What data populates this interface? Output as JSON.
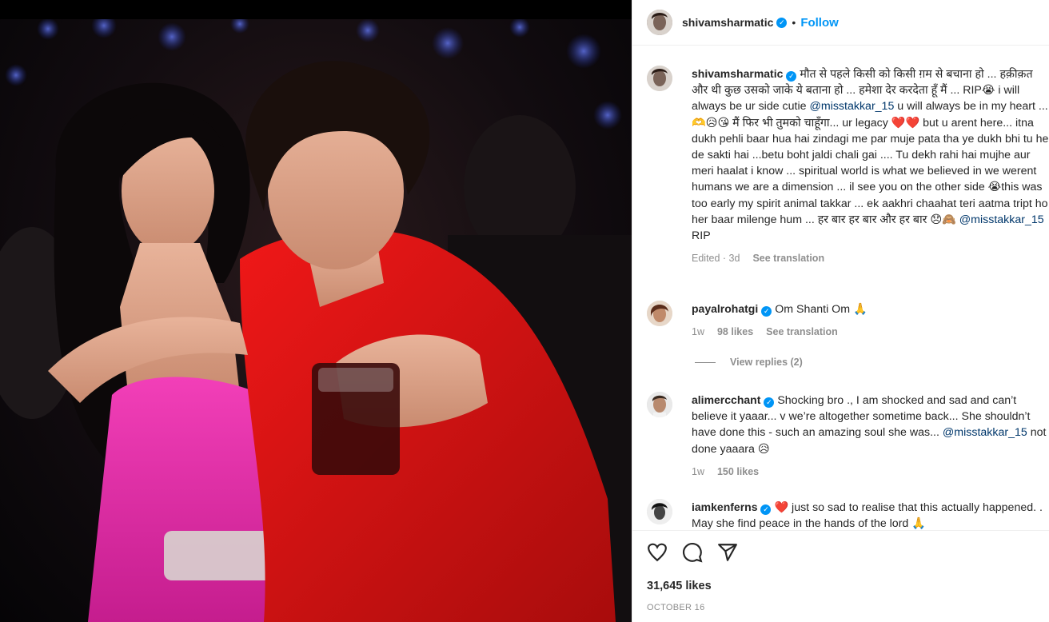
{
  "post": {
    "author": "shivamsharmatic",
    "follow_label": "Follow",
    "separator": "•",
    "caption": {
      "username": "shivamsharmatic",
      "text_1": "मौत से पहले किसी को किसी ग़म से बचाना हो ... हक़ीक़त और थी कुछ उसको जाके ये बताना हो ... हमेशा देर करदेता हूँ मैं ... RIP😭 i will always be ur side cutie ",
      "mention_1": "@misstakkar_15",
      "text_2": " u will always be in my heart ... 🫶😥😘 मैं फिर भी तुमको चाहूँगा... ur legacy ❤️❤️ but u arent here... itna dukh pehli baar hua hai zindagi me par muje pata tha ye dukh bhi tu he de sakti hai ...betu boht jaldi chali gai .... Tu dekh rahi hai mujhe aur meri haalat i know ... spiritual world is what we believed in we werent humans we are a dimension ... il see you on the other side 😭this was too early my spirit animal takkar ... ek aakhri chaahat teri aatma tript ho her baar milenge hum ... हर बार हर बार और हर बार 😞🙈",
      "mention_2": "@misstakkar_15",
      "text_3": " RIP",
      "time": "Edited · 3d",
      "translate": "See translation"
    },
    "comments": [
      {
        "username": "payalrohatgi",
        "text": "Om Shanti Om 🙏",
        "time": "1w",
        "likes": "98 likes",
        "translate": "See translation",
        "replies": "View replies (2)"
      },
      {
        "username": "alimercchant",
        "text": "Shocking bro ., I am shocked and sad and can’t believe it yaaar... v we’re altogether sometime back... She shouldn’t have done this - such an amazing soul she was... ",
        "mention": "@misstakkar_15",
        "text_after": " not done yaaara 😥",
        "time": "1w",
        "likes": "150 likes"
      },
      {
        "username": "iamkenferns",
        "text": "❤️ just so sad to realise that this actually happened. . May she find peace in the hands of the lord 🙏"
      }
    ],
    "likes": "31,645 likes",
    "date": "OCTOBER 16"
  },
  "icons": [
    "heart-icon",
    "comment-icon",
    "share-icon",
    "verified-badge-icon"
  ],
  "colors": {
    "link": "#0095f6",
    "mention": "#00376b",
    "muted": "#8e8e8e",
    "text": "#262626"
  }
}
